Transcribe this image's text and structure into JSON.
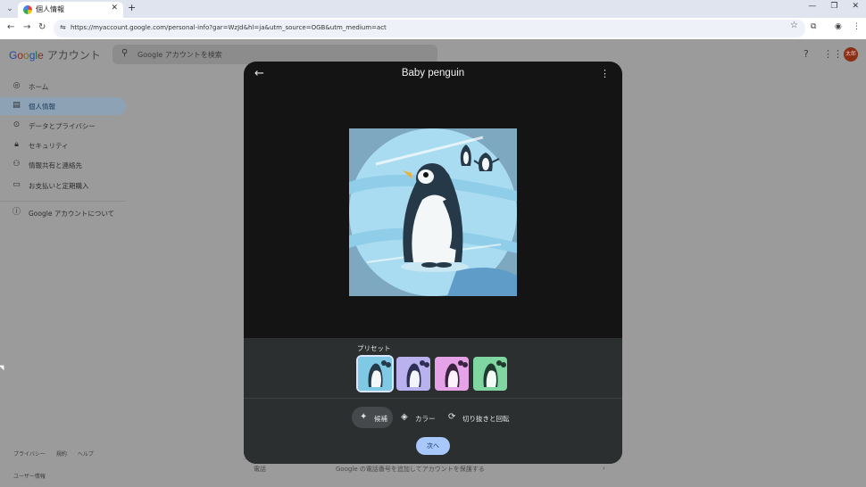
{
  "browser": {
    "tab_title": "個人情報",
    "url": "https://myaccount.google.com/personal-info?gar=WzJd&hl=ja&utm_source=OGB&utm_medium=act"
  },
  "header": {
    "logo_parts": [
      "G",
      "o",
      "o",
      "g",
      "l",
      "e"
    ],
    "logo_suffix": "アカウント",
    "search_placeholder": "Google アカウントを検索",
    "avatar_text": "太郎",
    "avatar_color": "#8a2f14"
  },
  "sidebar": {
    "items": [
      {
        "label": "ホーム",
        "icon": "person-circle-icon"
      },
      {
        "label": "個人情報",
        "icon": "id-card-icon",
        "active": true
      },
      {
        "label": "データとプライバシー",
        "icon": "toggle-icon"
      },
      {
        "label": "セキュリティ",
        "icon": "lock-icon"
      },
      {
        "label": "情報共有と連絡先",
        "icon": "people-icon"
      },
      {
        "label": "お支払いと定期購入",
        "icon": "credit-card-icon"
      }
    ],
    "about": {
      "label": "Google アカウントについて",
      "icon": "info-icon"
    }
  },
  "footer": {
    "links": [
      "プライバシー",
      "規約",
      "ヘルプ"
    ],
    "user_info": "ユーザー情報"
  },
  "dialog": {
    "title": "Baby penguin",
    "preset_label": "プリセット",
    "presets": [
      {
        "name": "blue",
        "color": "#7fc9e4",
        "selected": true
      },
      {
        "name": "purple",
        "color": "#b9b2ef"
      },
      {
        "name": "pink",
        "color": "#e6a2e6"
      },
      {
        "name": "green",
        "color": "#7fd6a0"
      }
    ],
    "tools": [
      {
        "label": "候補",
        "icon": "magic-wand-icon",
        "active": true
      },
      {
        "label": "カラー",
        "icon": "paint-bucket-icon"
      },
      {
        "label": "切り抜きと回転",
        "icon": "crop-rotate-icon"
      }
    ],
    "next_label": "次へ"
  },
  "behind": {
    "row_label": "電話",
    "row_text": "Google の電話番号を追加してアカウントを保護する"
  }
}
